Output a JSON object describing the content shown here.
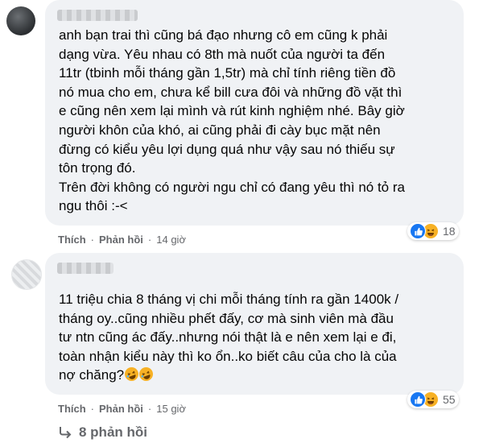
{
  "comments": [
    {
      "text": "anh bạn trai thì cũng bá đạo nhưng cô em cũng k phải\ndạng vừa. Yêu nhau có 8th mà nuốt của người ta đến\n11tr (tbinh mỗi tháng gần 1,5tr) mà chỉ tính riêng tiền đồ\nnó mua cho em, chưa kể bill cưa đôi và những đồ vặt thì\ne cũng nên xem lại mình và rút kinh nghiệm nhé. Bây giờ\nngười khôn của khó, ai cũng phải đi cày bục mặt nên\nđừng có kiểu yêu lợi dụng quá như vậy sau nó thiếu sự\ntôn trọng đó.\nTrên đời không có người ngu chỉ có đang yêu thì nó tỏ ra\nngu thôi :-<",
      "like_label": "Thích",
      "reply_label": "Phản hồi",
      "time": "14 giờ",
      "reaction_count": "18"
    },
    {
      "text": "11 triệu chia 8 tháng vị chi mỗi tháng tính ra gần 1400k /\ntháng oy..cũng nhiều phết đấy, cơ mà sinh viên mà đầu\ntư ntn cũng ác đấy..nhưng nói thật là e nên xem lại e đi,\ntoàn nhận kiểu này thì ko ổn..ko biết câu của cho là của\nnợ chăng?",
      "like_label": "Thích",
      "reply_label": "Phản hồi",
      "time": "15 giờ",
      "reaction_count": "55"
    }
  ],
  "view_replies": "8 phản hồi",
  "icons": {
    "like": "like-reaction-icon",
    "haha": "haha-reaction-icon",
    "replies": "reply-arrow-icon",
    "emoji": "rolling-laughing-emoji"
  },
  "colors": {
    "like": "#1877f2",
    "haha": "#f7b125",
    "bubble": "#f0f2f5",
    "meta": "#65676b"
  }
}
